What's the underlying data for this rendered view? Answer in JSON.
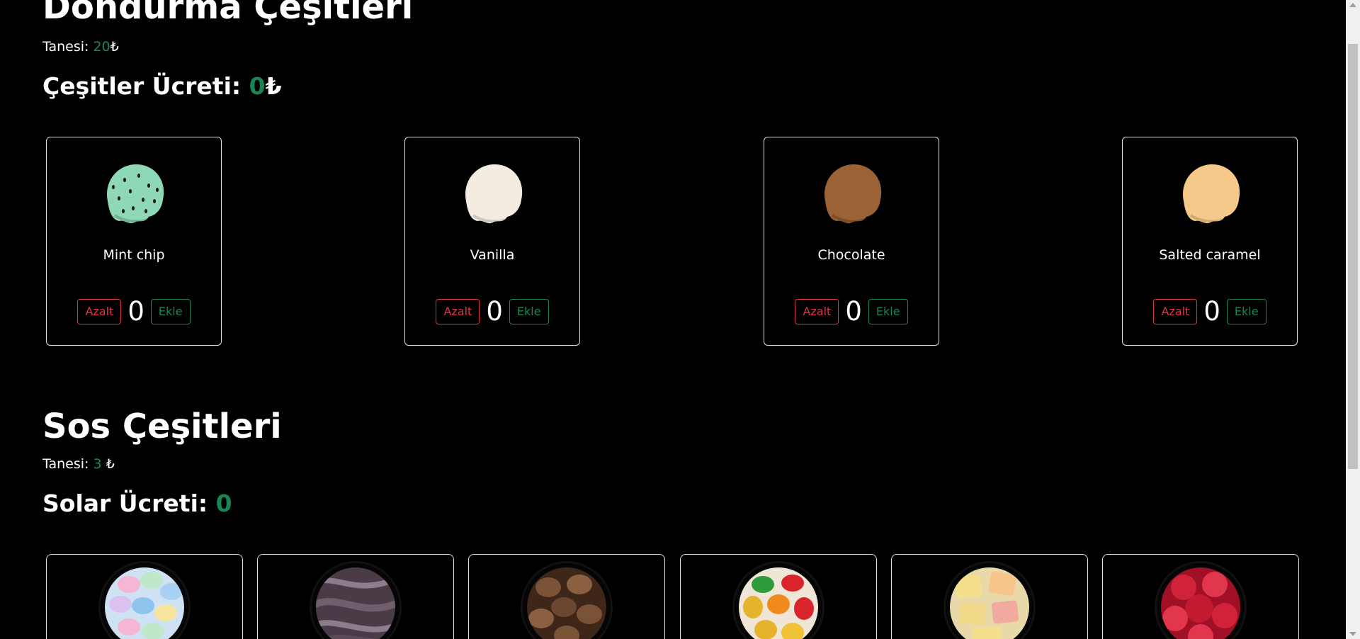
{
  "ice_cream_section": {
    "title": "Dondurma Çeşitleri",
    "unit_label": "Tanesi:",
    "unit_price": "20",
    "currency": "₺",
    "total_label": "Çeşitler Ücreti:",
    "total_value": "0",
    "decrease_label": "Azalt",
    "increase_label": "Ekle",
    "items": [
      {
        "name": "Mint chip",
        "count": "0",
        "color": "#8ed8b6"
      },
      {
        "name": "Vanilla",
        "count": "0",
        "color": "#f4ece0"
      },
      {
        "name": "Chocolate",
        "count": "0",
        "color": "#9b6236"
      },
      {
        "name": "Salted caramel",
        "count": "0",
        "color": "#f6c98a"
      }
    ]
  },
  "sauce_section": {
    "title": "Sos Çeşitleri",
    "unit_label": "Tanesi:",
    "unit_price": "3",
    "currency": "₺",
    "total_label": "Solar Ücreti:",
    "total_value": "0",
    "items": [
      {
        "icon": "candy-buttons-icon",
        "color": "#a8d0f0"
      },
      {
        "icon": "chocolate-shavings-icon",
        "color": "#5a4a56"
      },
      {
        "icon": "chocolate-chips-icon",
        "color": "#6b4630"
      },
      {
        "icon": "gummy-bears-icon",
        "color": "#e5b42c"
      },
      {
        "icon": "turkish-delight-icon",
        "color": "#f2d98a"
      },
      {
        "icon": "cherries-icon",
        "color": "#d0233a"
      }
    ]
  },
  "colors": {
    "accent_green": "#198754",
    "danger_red": "#dc3545",
    "background": "#000000"
  }
}
